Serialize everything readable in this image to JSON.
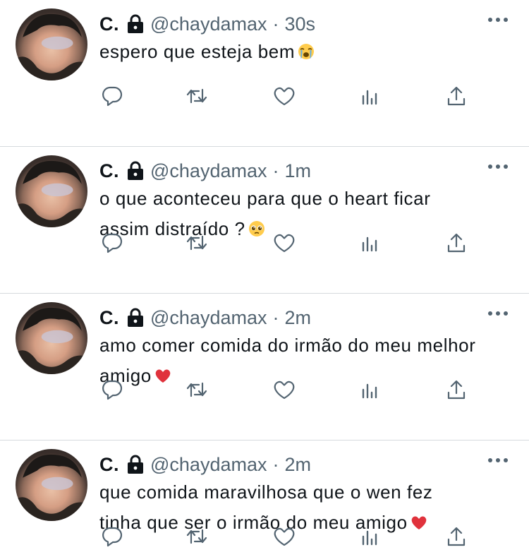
{
  "feed": {
    "tweets": [
      {
        "name": "C.",
        "handle": "@chaydamax",
        "separator": "·",
        "time": "30s",
        "text": "espero que esteja bem",
        "emoji": "loudly-crying-face"
      },
      {
        "name": "C.",
        "handle": "@chaydamax",
        "separator": "·",
        "time": "1m",
        "text": "o que aconteceu para que o heart ficar\nassim distraído ?",
        "emoji": "pleading-face"
      },
      {
        "name": "C.",
        "handle": "@chaydamax",
        "separator": "·",
        "time": "2m",
        "text": "amo comer comida do irmão do meu melhor\namigo",
        "emoji": "red-heart"
      },
      {
        "name": "C.",
        "handle": "@chaydamax",
        "separator": "·",
        "time": "2m",
        "text": "que comida maravilhosa que o wen fez\ntinha que ser o irmão do meu amigo",
        "emoji": "red-heart"
      }
    ],
    "icons": [
      "reply-icon",
      "retweet-icon",
      "like-icon",
      "views-icon",
      "share-icon",
      "lock-icon",
      "more-icon"
    ],
    "colors": {
      "text": "#0f1419",
      "secondary": "#536471",
      "divider": "#d6dadd",
      "heart": "#e0323c"
    }
  }
}
